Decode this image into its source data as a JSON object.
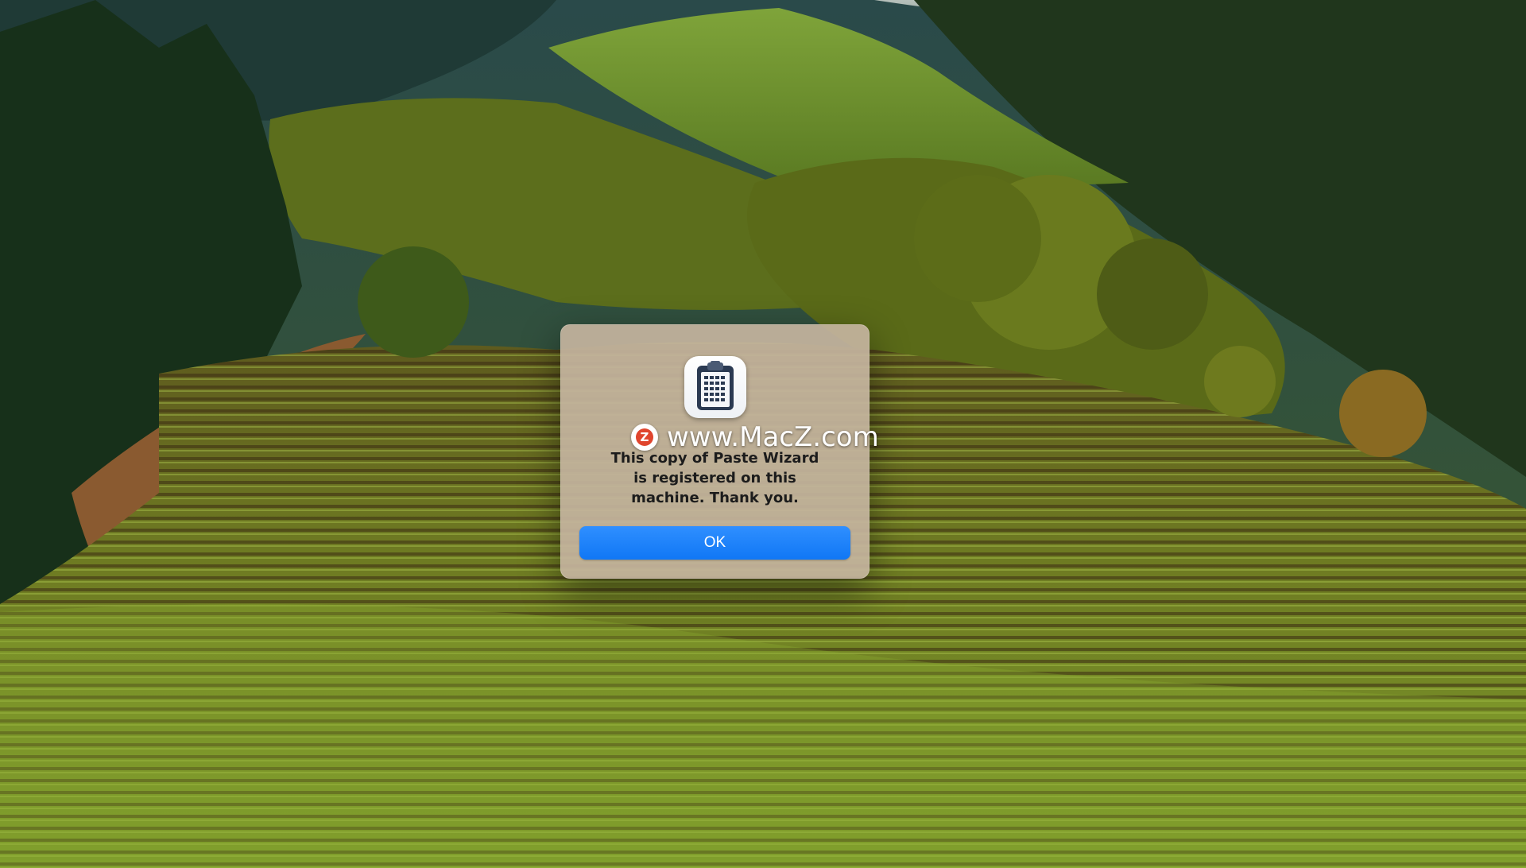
{
  "wallpaper": {
    "icon": "vineyard-landscape"
  },
  "alert": {
    "app_icon": "clipboard-icon",
    "watermark": {
      "badge_letter": "Z",
      "text": "www.MacZ.com"
    },
    "message": "This copy of Paste Wizard\nis registered on this\nmachine.  Thank you.",
    "ok_label": "OK",
    "colors": {
      "accent": "#1a7ffb",
      "panel": "#c4b49e"
    }
  }
}
